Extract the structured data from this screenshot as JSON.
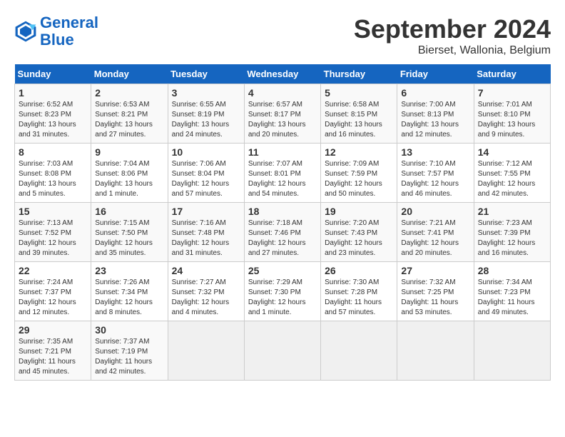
{
  "header": {
    "logo_line1": "General",
    "logo_line2": "Blue",
    "title": "September 2024",
    "subtitle": "Bierset, Wallonia, Belgium"
  },
  "calendar": {
    "days_of_week": [
      "Sunday",
      "Monday",
      "Tuesday",
      "Wednesday",
      "Thursday",
      "Friday",
      "Saturday"
    ],
    "weeks": [
      [
        {
          "day": "",
          "info": ""
        },
        {
          "day": "2",
          "info": "Sunrise: 6:53 AM\nSunset: 8:21 PM\nDaylight: 13 hours\nand 27 minutes."
        },
        {
          "day": "3",
          "info": "Sunrise: 6:55 AM\nSunset: 8:19 PM\nDaylight: 13 hours\nand 24 minutes."
        },
        {
          "day": "4",
          "info": "Sunrise: 6:57 AM\nSunset: 8:17 PM\nDaylight: 13 hours\nand 20 minutes."
        },
        {
          "day": "5",
          "info": "Sunrise: 6:58 AM\nSunset: 8:15 PM\nDaylight: 13 hours\nand 16 minutes."
        },
        {
          "day": "6",
          "info": "Sunrise: 7:00 AM\nSunset: 8:13 PM\nDaylight: 13 hours\nand 12 minutes."
        },
        {
          "day": "7",
          "info": "Sunrise: 7:01 AM\nSunset: 8:10 PM\nDaylight: 13 hours\nand 9 minutes."
        }
      ],
      [
        {
          "day": "1",
          "info": "Sunrise: 6:52 AM\nSunset: 8:23 PM\nDaylight: 13 hours\nand 31 minutes."
        },
        {
          "day": "",
          "info": ""
        },
        {
          "day": "",
          "info": ""
        },
        {
          "day": "",
          "info": ""
        },
        {
          "day": "",
          "info": ""
        },
        {
          "day": "",
          "info": ""
        },
        {
          "day": "",
          "info": ""
        }
      ],
      [
        {
          "day": "8",
          "info": "Sunrise: 7:03 AM\nSunset: 8:08 PM\nDaylight: 13 hours\nand 5 minutes."
        },
        {
          "day": "9",
          "info": "Sunrise: 7:04 AM\nSunset: 8:06 PM\nDaylight: 13 hours\nand 1 minute."
        },
        {
          "day": "10",
          "info": "Sunrise: 7:06 AM\nSunset: 8:04 PM\nDaylight: 12 hours\nand 57 minutes."
        },
        {
          "day": "11",
          "info": "Sunrise: 7:07 AM\nSunset: 8:01 PM\nDaylight: 12 hours\nand 54 minutes."
        },
        {
          "day": "12",
          "info": "Sunrise: 7:09 AM\nSunset: 7:59 PM\nDaylight: 12 hours\nand 50 minutes."
        },
        {
          "day": "13",
          "info": "Sunrise: 7:10 AM\nSunset: 7:57 PM\nDaylight: 12 hours\nand 46 minutes."
        },
        {
          "day": "14",
          "info": "Sunrise: 7:12 AM\nSunset: 7:55 PM\nDaylight: 12 hours\nand 42 minutes."
        }
      ],
      [
        {
          "day": "15",
          "info": "Sunrise: 7:13 AM\nSunset: 7:52 PM\nDaylight: 12 hours\nand 39 minutes."
        },
        {
          "day": "16",
          "info": "Sunrise: 7:15 AM\nSunset: 7:50 PM\nDaylight: 12 hours\nand 35 minutes."
        },
        {
          "day": "17",
          "info": "Sunrise: 7:16 AM\nSunset: 7:48 PM\nDaylight: 12 hours\nand 31 minutes."
        },
        {
          "day": "18",
          "info": "Sunrise: 7:18 AM\nSunset: 7:46 PM\nDaylight: 12 hours\nand 27 minutes."
        },
        {
          "day": "19",
          "info": "Sunrise: 7:20 AM\nSunset: 7:43 PM\nDaylight: 12 hours\nand 23 minutes."
        },
        {
          "day": "20",
          "info": "Sunrise: 7:21 AM\nSunset: 7:41 PM\nDaylight: 12 hours\nand 20 minutes."
        },
        {
          "day": "21",
          "info": "Sunrise: 7:23 AM\nSunset: 7:39 PM\nDaylight: 12 hours\nand 16 minutes."
        }
      ],
      [
        {
          "day": "22",
          "info": "Sunrise: 7:24 AM\nSunset: 7:37 PM\nDaylight: 12 hours\nand 12 minutes."
        },
        {
          "day": "23",
          "info": "Sunrise: 7:26 AM\nSunset: 7:34 PM\nDaylight: 12 hours\nand 8 minutes."
        },
        {
          "day": "24",
          "info": "Sunrise: 7:27 AM\nSunset: 7:32 PM\nDaylight: 12 hours\nand 4 minutes."
        },
        {
          "day": "25",
          "info": "Sunrise: 7:29 AM\nSunset: 7:30 PM\nDaylight: 12 hours\nand 1 minute."
        },
        {
          "day": "26",
          "info": "Sunrise: 7:30 AM\nSunset: 7:28 PM\nDaylight: 11 hours\nand 57 minutes."
        },
        {
          "day": "27",
          "info": "Sunrise: 7:32 AM\nSunset: 7:25 PM\nDaylight: 11 hours\nand 53 minutes."
        },
        {
          "day": "28",
          "info": "Sunrise: 7:34 AM\nSunset: 7:23 PM\nDaylight: 11 hours\nand 49 minutes."
        }
      ],
      [
        {
          "day": "29",
          "info": "Sunrise: 7:35 AM\nSunset: 7:21 PM\nDaylight: 11 hours\nand 45 minutes."
        },
        {
          "day": "30",
          "info": "Sunrise: 7:37 AM\nSunset: 7:19 PM\nDaylight: 11 hours\nand 42 minutes."
        },
        {
          "day": "",
          "info": ""
        },
        {
          "day": "",
          "info": ""
        },
        {
          "day": "",
          "info": ""
        },
        {
          "day": "",
          "info": ""
        },
        {
          "day": "",
          "info": ""
        }
      ]
    ]
  }
}
